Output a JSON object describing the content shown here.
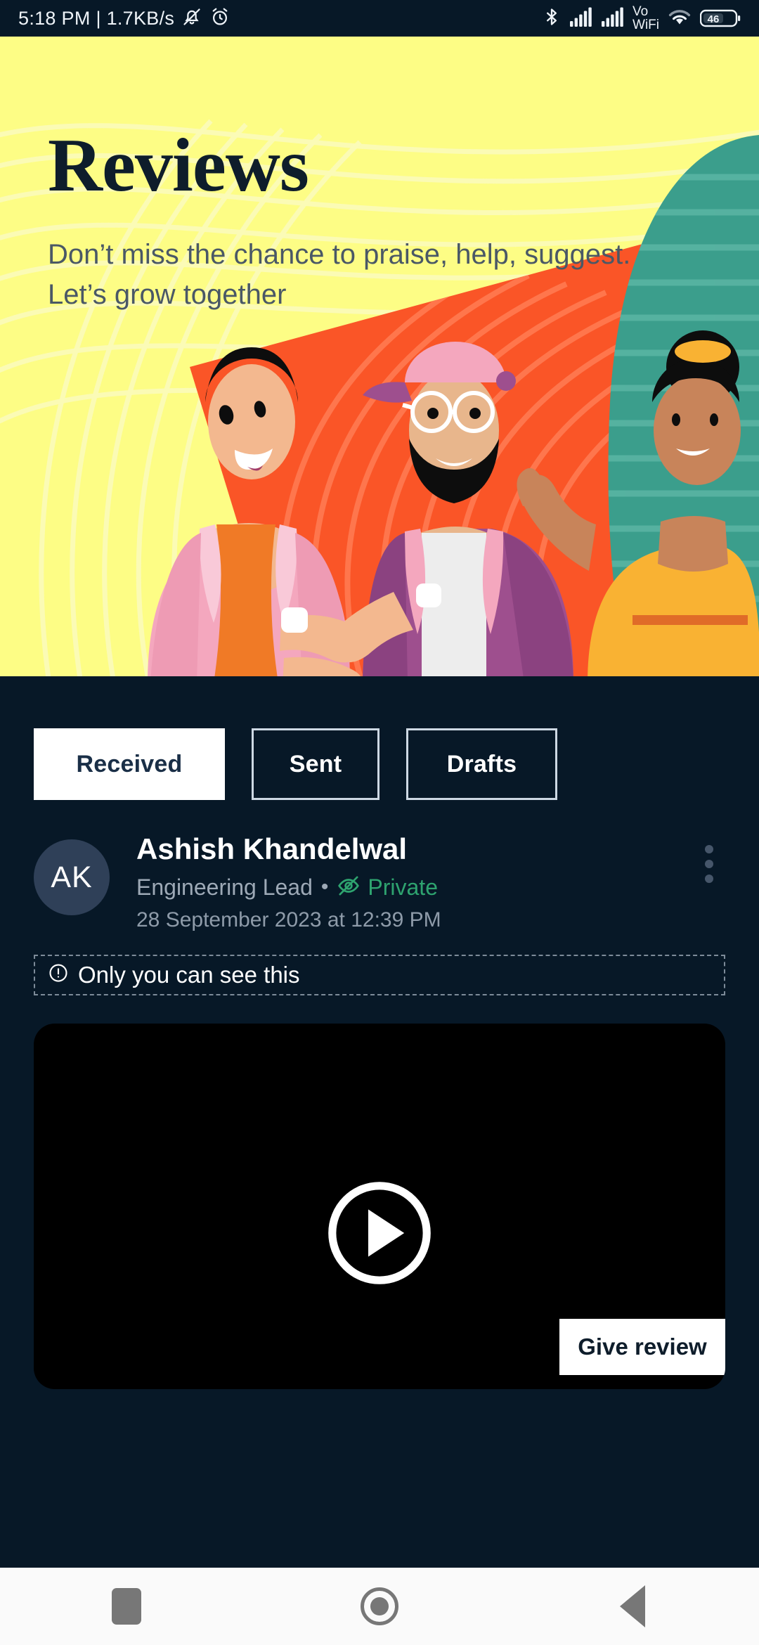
{
  "statusbar": {
    "time_and_rate": "5:18 PM | 1.7KB/s",
    "icons": [
      "silent-vibrate-icon",
      "alarm-icon",
      "bluetooth-icon",
      "signal-sim1-icon",
      "signal-sim2-icon",
      "vowifi-icon",
      "wifi-icon",
      "battery-icon"
    ],
    "vowifi_line1": "Vo",
    "vowifi_line2": "WiFi",
    "battery_level": "46"
  },
  "hero": {
    "title": "Reviews",
    "subtitle": "Don’t miss the chance to praise, help, suggest. Let’s grow together",
    "bg_color": "#FDFD85",
    "orange_color": "#FA5527",
    "teal_color": "#3B9E8C"
  },
  "tabs": [
    {
      "label": "Received",
      "active": true
    },
    {
      "label": "Sent",
      "active": false
    },
    {
      "label": "Drafts",
      "active": false
    }
  ],
  "review": {
    "avatar_initials": "AK",
    "name": "Ashish Khandelwal",
    "role": "Engineering Lead",
    "separator": "•",
    "visibility": "Private",
    "visibility_color": "#2EA36F",
    "date": "28 September 2023 at 12:39 PM",
    "menu_icon": "kebab-menu-icon",
    "notice_icon": "exclamation-circle-icon",
    "notice": "Only you can see this",
    "video": {
      "play_icon": "play-circle-icon",
      "give_review_label": "Give review"
    }
  },
  "navbar": {
    "recents_label": "recents-square-icon",
    "home_label": "home-circle-icon",
    "back_label": "back-triangle-icon"
  },
  "colors": {
    "background": "#071827",
    "accent_white": "#FFFFFF",
    "muted_text": "#9DA9B6"
  }
}
